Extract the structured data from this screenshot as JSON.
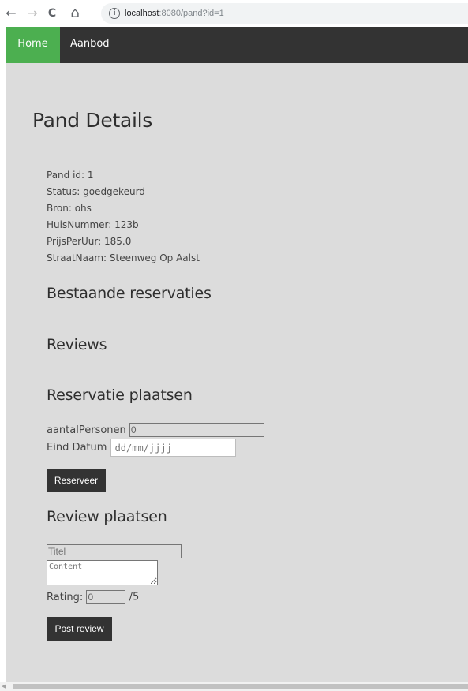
{
  "browser": {
    "back_icon": "←",
    "forward_icon": "→",
    "reload_icon": "C",
    "home_icon": "⌂",
    "info_icon": "i",
    "url_host": "localhost",
    "url_path": ":8080/pand?id=1"
  },
  "nav": {
    "home": "Home",
    "aanbod": "Aanbod",
    "active_color": "#4caf50",
    "bar_color": "#333333"
  },
  "page": {
    "title": "Pand Details",
    "details": [
      "Pand id: 1",
      "Status: goedgekeurd",
      "Bron: ohs",
      "HuisNummer: 123b",
      "PrijsPerUur: 185.0",
      "StraatNaam: Steenweg Op Aalst"
    ],
    "sections": {
      "reservaties": "Bestaande reservaties",
      "reviews": "Reviews",
      "reservatie_plaatsen": "Reservatie plaatsen",
      "review_plaatsen": "Review plaatsen"
    }
  },
  "reservation_form": {
    "aantal_label": "aantalPersonen",
    "aantal_value": "0",
    "eind_label": "Eind Datum",
    "eind_placeholder": "dd/mm/jjjj",
    "submit": "Reserveer"
  },
  "review_form": {
    "titel_placeholder": "Titel",
    "content_placeholder": "Content",
    "rating_label": "Rating:",
    "rating_value": "0",
    "rating_suffix": "/5",
    "submit": "Post review"
  }
}
